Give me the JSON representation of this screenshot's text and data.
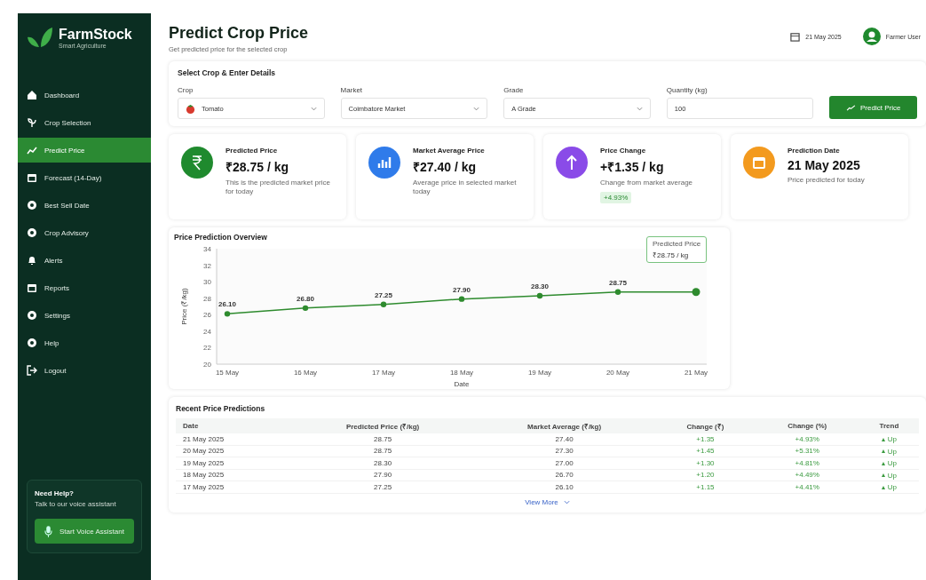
{
  "sidebar": {
    "brand": "FarmStock",
    "tagline": "Smart Agriculture",
    "items": [
      {
        "label": "Dashboard",
        "selected": false
      },
      {
        "label": "Crop Selection",
        "selected": false
      },
      {
        "label": "Predict Price",
        "selected": true
      },
      {
        "label": "Forecast (14-Day)",
        "selected": false
      },
      {
        "label": "Best Sell Date",
        "selected": false
      },
      {
        "label": "Crop Advisory",
        "selected": false
      },
      {
        "label": "Alerts",
        "selected": false
      },
      {
        "label": "Reports",
        "selected": false
      },
      {
        "label": "Settings",
        "selected": false
      },
      {
        "label": "Help",
        "selected": false
      },
      {
        "label": "Logout",
        "selected": false
      }
    ],
    "help": {
      "title": "Need Help?",
      "text": "Talk to our voice assistant",
      "button": "Start Voice Assistant"
    }
  },
  "header": {
    "title": "Predict Crop Price",
    "subtitle": "Get predicted price for the selected crop",
    "date": "21 May 2025",
    "user": "Farmer User"
  },
  "form": {
    "title": "Select Crop & Enter Details",
    "fields": [
      {
        "label": "Crop",
        "value": "Tomato",
        "kind": "select-crop"
      },
      {
        "label": "Market",
        "value": "Coimbatore Market",
        "kind": "select"
      },
      {
        "label": "Grade",
        "value": "A Grade",
        "kind": "select"
      },
      {
        "label": "Quantity (kg)",
        "value": "100",
        "kind": "input"
      }
    ],
    "button": "Predict Price"
  },
  "cards": [
    {
      "title": "Predicted Price",
      "value": "₹28.75 / kg",
      "note": "This is the predicted market price for today",
      "color": "#1f8a2e"
    },
    {
      "title": "Market Average Price",
      "value": "₹27.40 / kg",
      "note": "Average price in selected market today",
      "color": "#2f7bea"
    },
    {
      "title": "Price Change",
      "value": "+₹1.35 / kg",
      "note": "Change from market average",
      "badge": "+4.93%",
      "color": "#8a4be8"
    },
    {
      "title": "Prediction Date",
      "value": "21 May 2025",
      "note": "Price predicted for today",
      "color": "#f39a1e"
    }
  ],
  "chart": {
    "title": "Price Prediction Overview",
    "tooltip": {
      "value": "₹28.75 / kg"
    },
    "chart_data": {
      "type": "line",
      "xlabel": "Date",
      "ylabel": "Price (₹/kg)",
      "categories": [
        "15 May",
        "16 May",
        "17 May",
        "18 May",
        "19 May",
        "20 May",
        "21 May"
      ],
      "series": [
        {
          "name": "Predicted Price",
          "color": "#2e8b2e",
          "marker": "o",
          "values": [
            26.1,
            26.8,
            27.25,
            27.9,
            28.3,
            28.75,
            28.75
          ]
        }
      ],
      "ylim": [
        20,
        34
      ],
      "yticks": [
        20,
        22,
        24,
        26,
        28,
        30,
        32,
        34
      ],
      "value_labels": [
        "26.10",
        "26.80",
        "27.25",
        "27.90",
        "28.30",
        "28.75"
      ]
    }
  },
  "table": {
    "title": "Recent Price Predictions",
    "columns": [
      "Date",
      "Predicted Price (₹/kg)",
      "Market Average (₹/kg)",
      "Change (₹)",
      "Change (%)",
      "Trend"
    ],
    "rows": [
      [
        "21 May 2025",
        "28.75",
        "27.40",
        "+1.35",
        "+4.93%",
        "Up"
      ],
      [
        "20 May 2025",
        "28.75",
        "27.30",
        "+1.45",
        "+5.31%",
        "Up"
      ],
      [
        "19 May 2025",
        "28.30",
        "27.00",
        "+1.30",
        "+4.81%",
        "Up"
      ],
      [
        "18 May 2025",
        "27.90",
        "26.70",
        "+1.20",
        "+4.49%",
        "Up"
      ],
      [
        "17 May 2025",
        "27.25",
        "26.10",
        "+1.15",
        "+4.41%",
        "Up"
      ]
    ],
    "more": "View More"
  }
}
